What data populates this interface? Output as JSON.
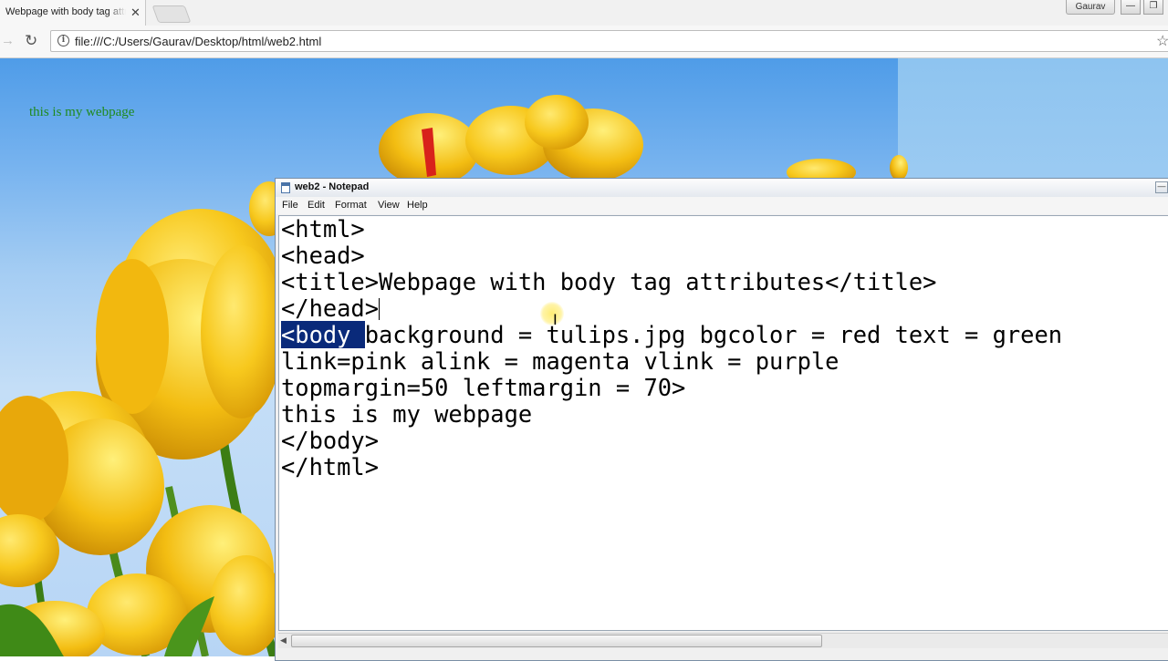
{
  "browser": {
    "tab_title": "Webpage with body tag attributes",
    "tab_close": "✕",
    "profile": "Gaurav",
    "url": "file:///C:/Users/Gaurav/Desktop/html/web2.html",
    "icons": {
      "forward": "→",
      "reload": "↻",
      "info": "i",
      "star": "☆",
      "minimize": "—",
      "restore": "❐"
    }
  },
  "page": {
    "text": "this is my webpage",
    "text_color": "#1f8a1f"
  },
  "notepad": {
    "title": "web2 - Notepad",
    "menu": [
      "File",
      "Edit",
      "Format",
      "View",
      "Help"
    ],
    "lines": [
      "<html>",
      "<head>",
      "<title>Webpage with body tag attributes</title>",
      "</head>",
      "<body ",
      "background = tulips.jpg bgcolor = red text = green",
      "link=pink alink = magenta vlink = purple",
      "topmargin=50 leftmargin = 70>",
      "this is my webpage",
      "</body>",
      "</html>"
    ],
    "selection_color": "#0a2a7a"
  }
}
